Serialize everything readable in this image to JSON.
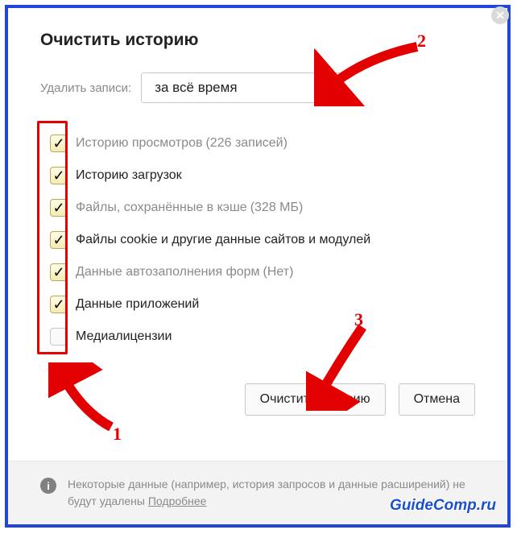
{
  "dialog": {
    "title": "Очистить историю",
    "range_label": "Удалить записи:",
    "range_value": "за всё время"
  },
  "checks": [
    {
      "checked": true,
      "label": "Историю просмотров",
      "hint": "(226 записей)",
      "muted": true
    },
    {
      "checked": true,
      "label": "Историю загрузок",
      "hint": "",
      "muted": false
    },
    {
      "checked": true,
      "label": "Файлы, сохранённые в кэше",
      "hint": "(328 МБ)",
      "muted": true
    },
    {
      "checked": true,
      "label": "Файлы cookie и другие данные сайтов и модулей",
      "hint": "",
      "muted": false
    },
    {
      "checked": true,
      "label": "Данные автозаполнения форм",
      "hint": "(Нет)",
      "muted": true
    },
    {
      "checked": true,
      "label": "Данные приложений",
      "hint": "",
      "muted": false
    },
    {
      "checked": false,
      "label": "Медиалицензии",
      "hint": "",
      "muted": false
    }
  ],
  "buttons": {
    "clear": "Очистить историю",
    "cancel": "Отмена"
  },
  "footer": {
    "text": "Некоторые данные (например, история запросов и данные расширений) не будут удалены ",
    "link": "Подробнее"
  },
  "annotations": {
    "n1": "1",
    "n2": "2",
    "n3": "3"
  },
  "watermark": "GuideComp.ru"
}
